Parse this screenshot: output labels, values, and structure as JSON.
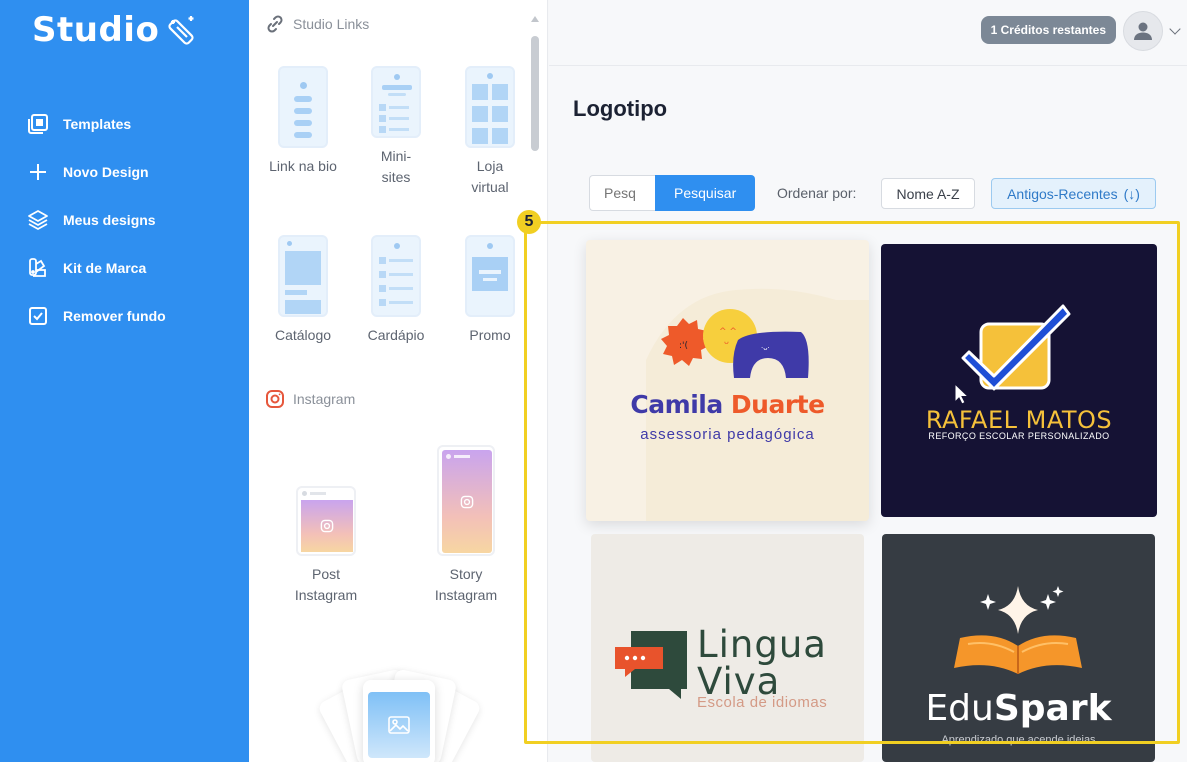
{
  "brand": {
    "name": "Studio"
  },
  "nav": [
    {
      "label": "Templates",
      "icon": "templates-icon"
    },
    {
      "label": "Novo Design",
      "icon": "plus-icon"
    },
    {
      "label": "Meus designs",
      "icon": "layers-icon"
    },
    {
      "label": "Kit de Marca",
      "icon": "brand-kit-icon"
    },
    {
      "label": "Remover fundo",
      "icon": "checkbox-icon"
    }
  ],
  "panel": {
    "studio_links_title": "Studio Links",
    "instagram_title": "Instagram",
    "templates": [
      {
        "label": "Link na bio"
      },
      {
        "label": "Mini-sites"
      },
      {
        "label": "Loja virtual"
      },
      {
        "label": "Catálogo"
      },
      {
        "label": "Cardápio"
      },
      {
        "label": "Promo"
      },
      {
        "label": "Post Instagram"
      },
      {
        "label": "Story Instagram"
      }
    ]
  },
  "header": {
    "credits": "1 Créditos restantes"
  },
  "main": {
    "title": "Logotipo",
    "search": {
      "placeholder": "Pesq",
      "button": "Pesquisar"
    },
    "order_label": "Ordenar por:",
    "sort_name": "Nome A-Z",
    "sort_old": "Antigos-Recentes",
    "sort_arrow": "(↓)",
    "highlight_badge": "5"
  },
  "logos": {
    "camila": {
      "name_part1": "Camila ",
      "name_part2": "Duarte",
      "subtitle": "assessoria pedagógica"
    },
    "rafael": {
      "name": "RAFAEL MATOS",
      "subtitle": "REFORÇO ESCOLAR PERSONALIZADO"
    },
    "lingua": {
      "line1": "Lingua",
      "line2": "Viva",
      "subtitle": "Escola de idiomas"
    },
    "edu": {
      "part1": "Edu",
      "part2": "Spark",
      "subtitle": "Aprendizado que acende ideias"
    }
  },
  "colors": {
    "sidebar": "#2f8ff0",
    "accent": "#2f8ff0",
    "highlight": "#f1cf22",
    "credits_badge": "#7c8896"
  }
}
